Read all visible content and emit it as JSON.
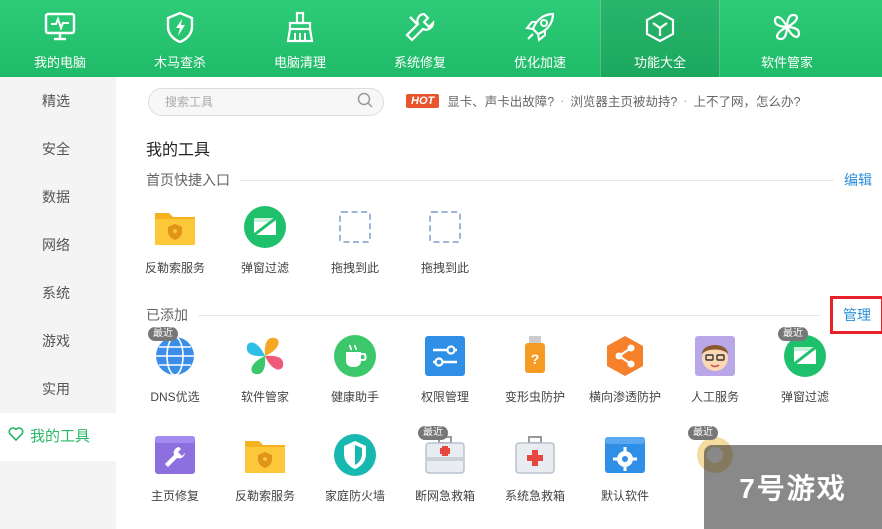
{
  "nav": {
    "items": [
      {
        "label": "我的电脑",
        "icon": "monitor-icon"
      },
      {
        "label": "木马查杀",
        "icon": "shield-bolt-icon"
      },
      {
        "label": "电脑清理",
        "icon": "broom-icon"
      },
      {
        "label": "系统修复",
        "icon": "wrench-icon"
      },
      {
        "label": "优化加速",
        "icon": "rocket-icon"
      },
      {
        "label": "功能大全",
        "icon": "cube-icon"
      },
      {
        "label": "软件管家",
        "icon": "flower-icon"
      }
    ],
    "active_index": 5
  },
  "sidebar": {
    "items": [
      "精选",
      "安全",
      "数据",
      "网络",
      "系统",
      "游戏",
      "实用",
      "我的工具"
    ],
    "active_index": 7
  },
  "search": {
    "placeholder": "搜索工具"
  },
  "hot": {
    "badge": "HOT",
    "links": [
      "显卡、声卡出故障?",
      "浏览器主页被劫持?",
      "上不了网，怎么办?"
    ],
    "separator": "·"
  },
  "section_title": "我的工具",
  "quick": {
    "heading": "首页快捷入口",
    "action": "编辑",
    "tiles": [
      {
        "label": "反勒索服务",
        "icon": "ransom-folder-icon"
      },
      {
        "label": "弹窗过滤",
        "icon": "popup-filter-icon"
      },
      {
        "label": "拖拽到此",
        "icon": "drop-slot-icon"
      },
      {
        "label": "拖拽到此",
        "icon": "drop-slot-icon"
      }
    ]
  },
  "added": {
    "heading": "已添加",
    "action": "管理",
    "badge_text": "最近",
    "row1": [
      {
        "label": "DNS优选",
        "icon": "globe-icon",
        "badge": true
      },
      {
        "label": "软件管家",
        "icon": "flower-icon",
        "badge": false
      },
      {
        "label": "健康助手",
        "icon": "coffee-icon",
        "badge": false
      },
      {
        "label": "权限管理",
        "icon": "sliders-icon",
        "badge": false
      },
      {
        "label": "变形虫防护",
        "icon": "usb-shield-icon",
        "badge": false
      },
      {
        "label": "横向渗透防护",
        "icon": "share-icon",
        "badge": false
      },
      {
        "label": "人工服务",
        "icon": "agent-icon",
        "badge": false
      },
      {
        "label": "弹窗过滤",
        "icon": "popup-filter-icon",
        "badge": true
      }
    ],
    "row2": [
      {
        "label": "主页修复",
        "icon": "repair-icon",
        "badge": false
      },
      {
        "label": "反勒索服务",
        "icon": "ransom-folder-icon",
        "badge": false
      },
      {
        "label": "家庭防火墙",
        "icon": "firewall-icon",
        "badge": false
      },
      {
        "label": "断网急救箱",
        "icon": "network-kit-icon",
        "badge": true
      },
      {
        "label": "系统急救箱",
        "icon": "system-kit-icon",
        "badge": false
      },
      {
        "label": "默认软件",
        "icon": "gear-window-icon",
        "badge": false
      }
    ]
  },
  "watermark": {
    "text": "7号游戏"
  }
}
